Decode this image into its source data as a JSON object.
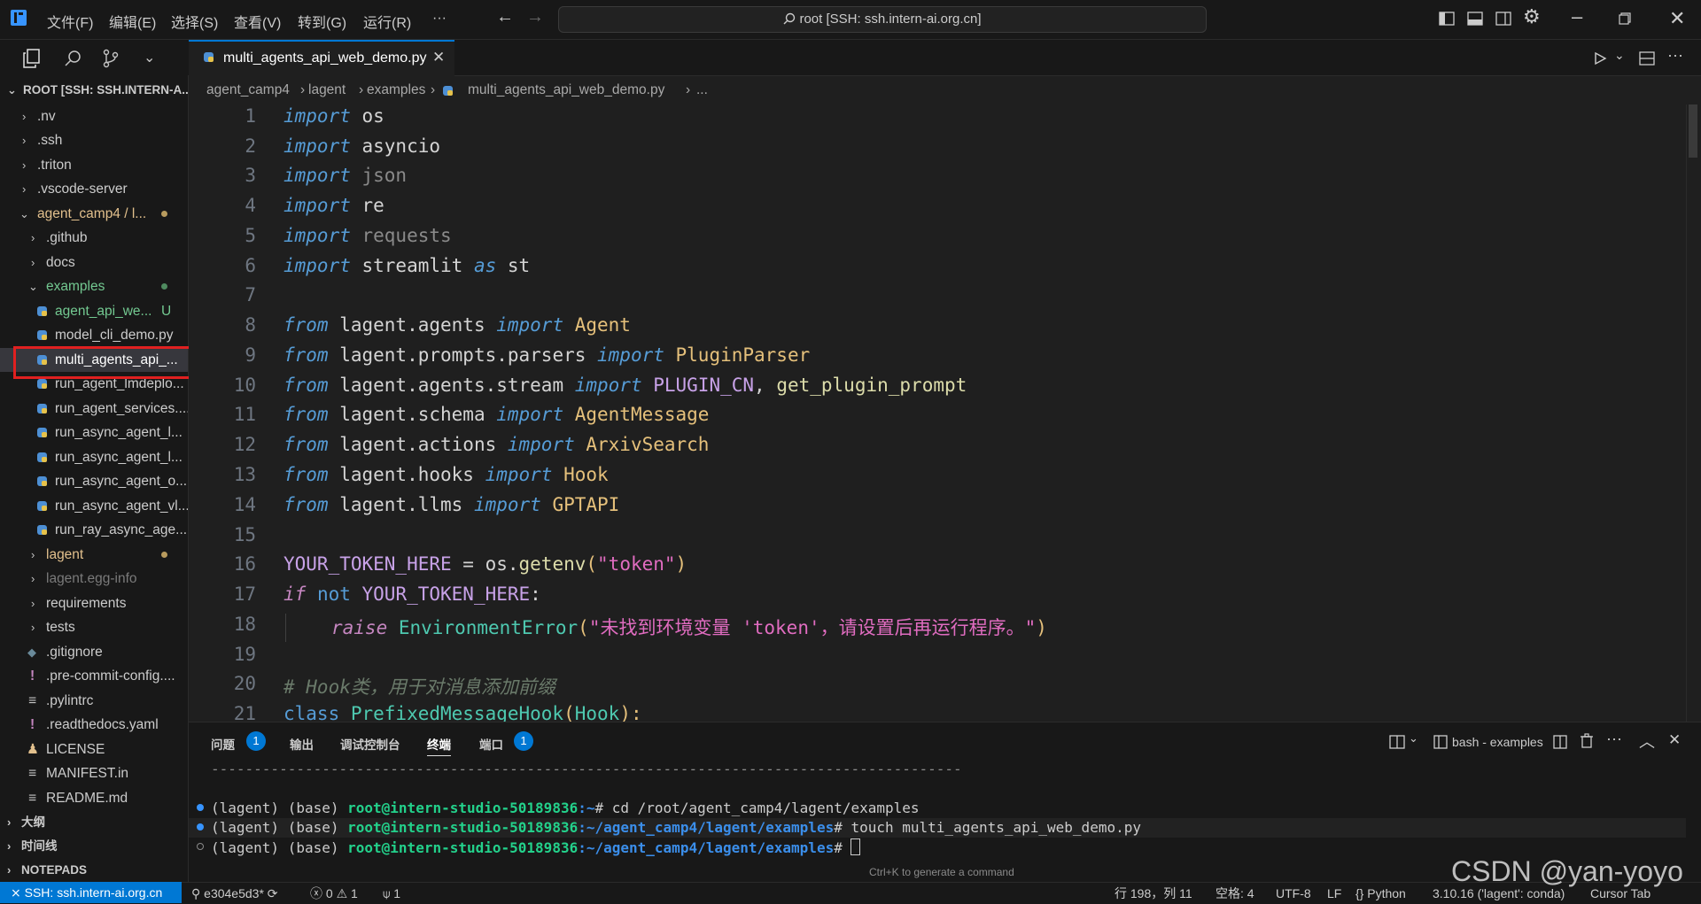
{
  "menu": [
    "文件(F)",
    "编辑(E)",
    "选择(S)",
    "查看(V)",
    "转到(G)",
    "运行(R)",
    "···"
  ],
  "search_text": "root [SSH: ssh.intern-ai.org.cn]",
  "explorer": {
    "root_label": "ROOT [SSH: SSH.INTERN-A...",
    "items": [
      {
        "label": ".nv"
      },
      {
        "label": ".ssh"
      },
      {
        "label": ".triton"
      },
      {
        "label": ".vscode-server"
      },
      {
        "label": "agent_camp4 / l..."
      },
      {
        "label": ".github"
      },
      {
        "label": "docs"
      },
      {
        "label": "examples"
      },
      {
        "label": "agent_api_we...",
        "badge": "U"
      },
      {
        "label": "model_cli_demo.py"
      },
      {
        "label": "multi_agents_api_..."
      },
      {
        "label": "run_agent_lmdeplo..."
      },
      {
        "label": "run_agent_services...."
      },
      {
        "label": "run_async_agent_l..."
      },
      {
        "label": "run_async_agent_l..."
      },
      {
        "label": "run_async_agent_o..."
      },
      {
        "label": "run_async_agent_vl..."
      },
      {
        "label": "run_ray_async_age..."
      },
      {
        "label": "lagent"
      },
      {
        "label": "lagent.egg-info"
      },
      {
        "label": "requirements"
      },
      {
        "label": "tests"
      },
      {
        "label": ".gitignore"
      },
      {
        "label": ".pre-commit-config...."
      },
      {
        "label": ".pylintrc"
      },
      {
        "label": ".readthedocs.yaml"
      },
      {
        "label": "LICENSE"
      },
      {
        "label": "MANIFEST.in"
      },
      {
        "label": "README.md"
      }
    ],
    "sections": [
      "大纲",
      "时间线",
      "NOTEPADS"
    ]
  },
  "tab": {
    "label": "multi_agents_api_web_demo.py"
  },
  "breadcrumb": [
    "agent_camp4",
    "lagent",
    "examples",
    "multi_agents_api_web_demo.py",
    "..."
  ],
  "line_numbers": [
    "1",
    "2",
    "3",
    "4",
    "5",
    "6",
    "7",
    "8",
    "9",
    "10",
    "11",
    "12",
    "13",
    "14",
    "15",
    "16",
    "17",
    "18",
    "19",
    "20",
    "21"
  ],
  "code": {
    "l1": [
      "import",
      " os"
    ],
    "l2": [
      "import",
      " asyncio"
    ],
    "l3": [
      "import",
      " json"
    ],
    "l4": [
      "import",
      " re"
    ],
    "l5": [
      "import",
      " requests"
    ],
    "l6": [
      "import",
      " streamlit ",
      "as",
      " st"
    ],
    "l8": [
      "from",
      " lagent.agents ",
      "import",
      " Agent"
    ],
    "l9": [
      "from",
      " lagent.prompts.parsers ",
      "import",
      " PluginParser"
    ],
    "l10": [
      "from",
      " lagent.agents.stream ",
      "import",
      " PLUGIN_CN",
      ", ",
      "get_plugin_prompt"
    ],
    "l11": [
      "from",
      " lagent.schema ",
      "import",
      " AgentMessage"
    ],
    "l12": [
      "from",
      " lagent.actions ",
      "import",
      " ArxivSearch"
    ],
    "l13": [
      "from",
      " lagent.hooks ",
      "import",
      " Hook"
    ],
    "l14": [
      "from",
      " lagent.llms ",
      "import",
      " GPTAPI"
    ],
    "l16": [
      "YOUR_TOKEN_HERE",
      " = os.",
      "getenv",
      "(",
      "\"token\"",
      ")"
    ],
    "l17": [
      "if",
      " not ",
      "YOUR_TOKEN_HERE",
      ":"
    ],
    "l18": [
      "raise",
      " EnvironmentError",
      "(",
      "\"未找到环境变量 'token'，请设置后再运行程序。\"",
      ")"
    ],
    "l20": "# Hook类，用于对消息添加前缀",
    "l21": [
      "class",
      " PrefixedMessageHook",
      "(",
      "Hook",
      "):"
    ]
  },
  "panel": {
    "tabs": [
      "问题",
      "输出",
      "调试控制台",
      "终端",
      "端口"
    ],
    "problems_count": "1",
    "ports_count": "1",
    "terminal_name": "bash - examples",
    "separator": "----------------------------------------------------------------------------------------",
    "lines": [
      {
        "prefix": "(lagent) (base) ",
        "user": "root@intern-studio-50189836",
        "path": ":~",
        "cmd": "# cd /root/agent_camp4/lagent/examples"
      },
      {
        "prefix": "(lagent) (base) ",
        "user": "root@intern-studio-50189836",
        "path": ":~/agent_camp4/lagent/examples",
        "cmd": "# touch multi_agents_api_web_demo.py"
      },
      {
        "prefix": "(lagent) (base) ",
        "user": "root@intern-studio-50189836",
        "path": ":~/agent_camp4/lagent/examples",
        "cmd": "# "
      }
    ],
    "hint": "Ctrl+K to generate a command"
  },
  "status": {
    "remote": "SSH: ssh.intern-ai.org.cn",
    "branch": "e304e5d3*",
    "errors": "0",
    "warnings": "1",
    "ports": "1",
    "position": "行 198，列 11",
    "spaces": "空格: 4",
    "encoding": "UTF-8",
    "eol": "LF",
    "language": "Python",
    "interpreter": "3.10.16 ('lagent': conda)",
    "cursor_tab": "Cursor Tab"
  },
  "watermark": "CSDN @yan-yoyo",
  "colors": {
    "accent": "#0078d4",
    "highlight_box": "#e02020"
  }
}
